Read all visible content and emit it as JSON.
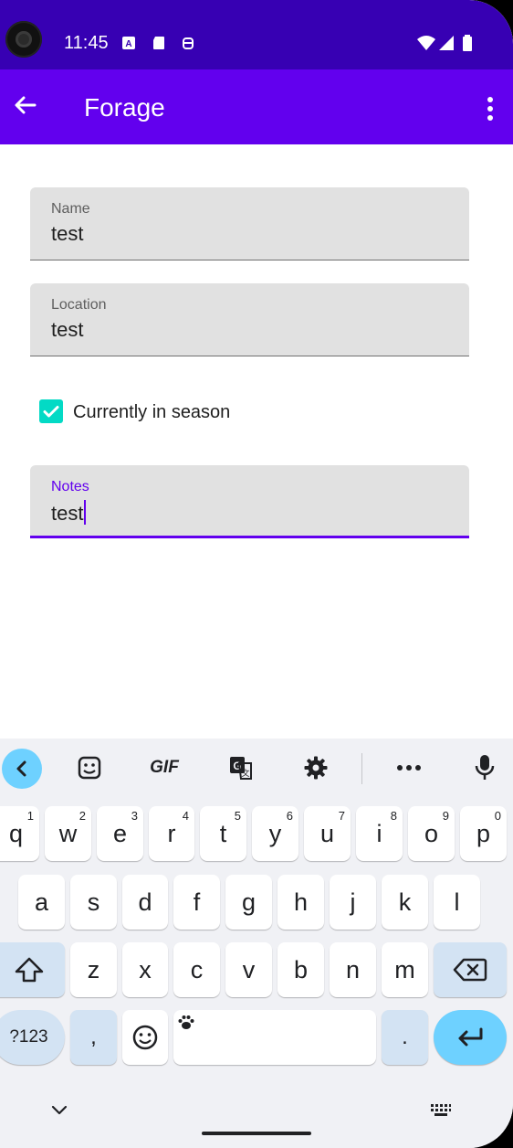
{
  "status_bar": {
    "time": "11:45",
    "icons": [
      "a-icon",
      "sd-card-icon",
      "android-icon",
      "wifi-icon",
      "signal-icon",
      "battery-icon"
    ]
  },
  "app_bar": {
    "title": "Forage",
    "back_icon": "arrow-back-icon",
    "menu_icon": "more-vert-icon",
    "color": "#6200ee",
    "status_color": "#3700b3"
  },
  "form": {
    "name": {
      "label": "Name",
      "value": "test"
    },
    "location": {
      "label": "Location",
      "value": "test"
    },
    "in_season": {
      "label": "Currently in season",
      "checked": true
    },
    "notes": {
      "label": "Notes",
      "value": "test",
      "focused": true
    }
  },
  "keyboard": {
    "toolbar": [
      "back-chevron-icon",
      "sticker-icon",
      "GIF",
      "translate-icon",
      "settings-icon",
      "more-icon",
      "mic-icon"
    ],
    "gif_label": "GIF",
    "row1": [
      {
        "k": "q",
        "h": "1"
      },
      {
        "k": "w",
        "h": "2"
      },
      {
        "k": "e",
        "h": "3"
      },
      {
        "k": "r",
        "h": "4"
      },
      {
        "k": "t",
        "h": "5"
      },
      {
        "k": "y",
        "h": "6"
      },
      {
        "k": "u",
        "h": "7"
      },
      {
        "k": "i",
        "h": "8"
      },
      {
        "k": "o",
        "h": "9"
      },
      {
        "k": "p",
        "h": "0"
      }
    ],
    "row2": [
      "a",
      "s",
      "d",
      "f",
      "g",
      "h",
      "j",
      "k",
      "l"
    ],
    "row3": [
      "z",
      "x",
      "c",
      "v",
      "b",
      "n",
      "m"
    ],
    "sym_label": "?123",
    "comma": ",",
    "period": ".",
    "accent": "#6ed1ff"
  }
}
